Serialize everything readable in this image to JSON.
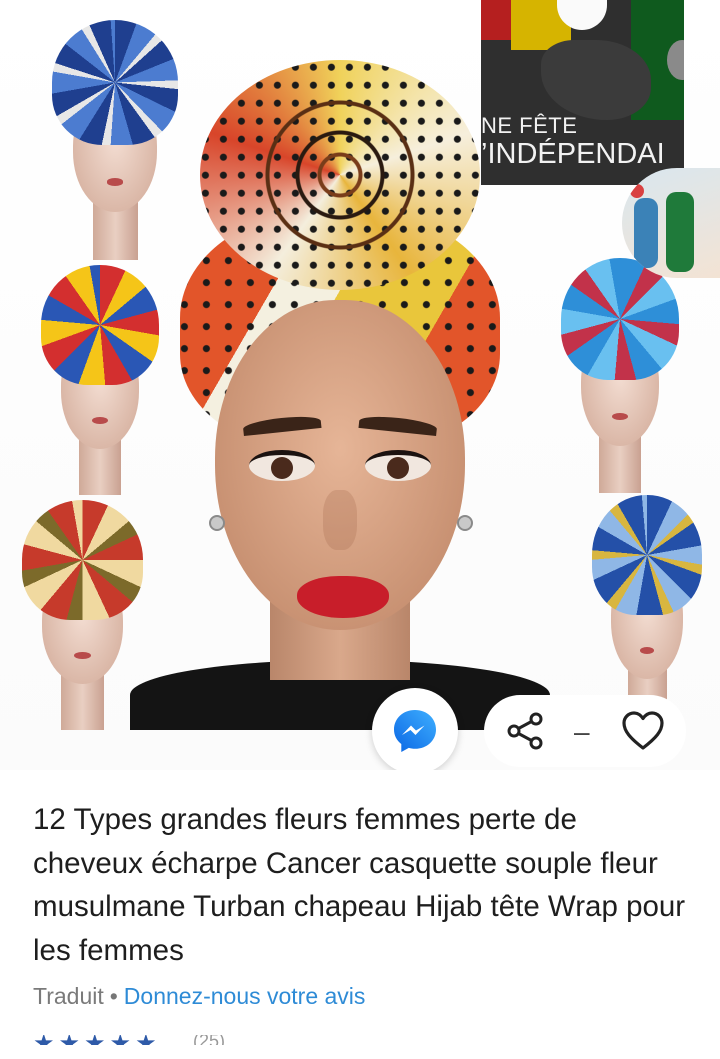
{
  "ad_overlay": {
    "line1": "NE FÊTE",
    "line2": "’INDÉPENDAI"
  },
  "product": {
    "title": "12 Types grandes fleurs femmes perte de cheveux écharpe Cancer casquette souple fleur musulmane Turban chapeau Hijab tête Wrap pour les femmes",
    "translated_label": "Traduit",
    "separator": "•",
    "feedback_link": "Donnez-nous votre avis",
    "rating_stars": "★★★★★",
    "rating_count": "(25)"
  },
  "actions": {
    "share_icon": "share-icon",
    "separator": "–",
    "favorite_icon": "heart-icon",
    "messenger_icon": "messenger-icon"
  },
  "colors": {
    "accent_blue": "#3fa6de",
    "link_blue": "#2e8bd6",
    "messenger_blue": "#1a7bf0"
  }
}
